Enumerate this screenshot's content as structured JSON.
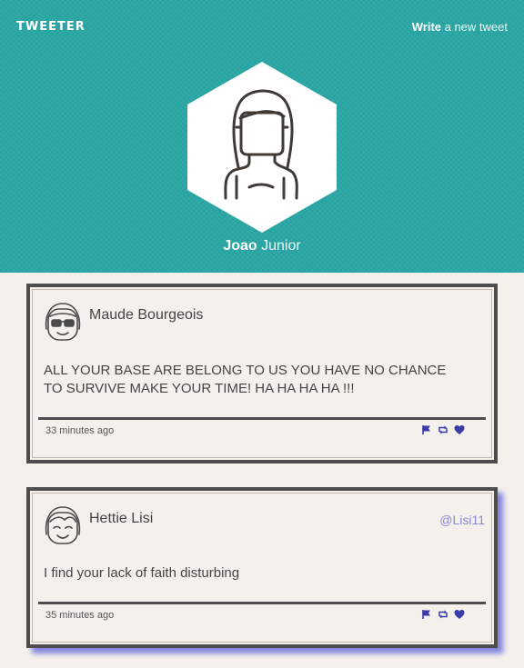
{
  "nav": {
    "brand": "TWEETER",
    "write_strong": "Write",
    "write_rest": " a new tweet"
  },
  "profile": {
    "first_name": "Joao",
    "last_name": " Junior"
  },
  "colors": {
    "header_bg": "#2aa7a5",
    "action_icons": "#3a3aa8",
    "handle": "#8a88d8"
  },
  "tweets": [
    {
      "author": "Maude Bourgeois",
      "handle": "",
      "text": "ALL YOUR BASE ARE BELONG TO US YOU HAVE NO CHANCE TO SURVIVE MAKE YOUR TIME! HA HA HA HA !!!",
      "time": "33 minutes ago",
      "avatar_icon": "girl-with-glasses-icon"
    },
    {
      "author": "Hettie Lisi",
      "handle": "@Lisi11",
      "text": "I find your lack of faith disturbing",
      "time": "35 minutes ago",
      "avatar_icon": "smiling-girl-icon"
    }
  ],
  "actions": [
    "flag-icon",
    "retweet-icon",
    "heart-icon"
  ]
}
